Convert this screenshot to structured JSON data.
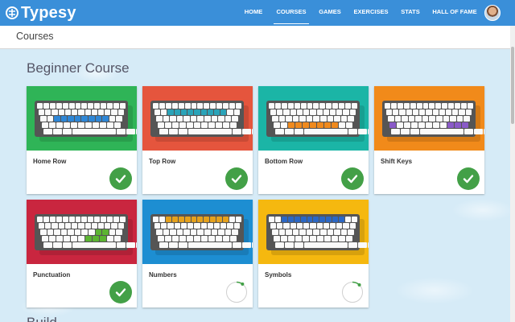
{
  "app": {
    "logo_text": "Typesy"
  },
  "nav": {
    "items": [
      {
        "label": "HOME",
        "active": false
      },
      {
        "label": "COURSES",
        "active": true
      },
      {
        "label": "GAMES",
        "active": false
      },
      {
        "label": "EXERCISES",
        "active": false
      },
      {
        "label": "STATS",
        "active": false
      },
      {
        "label": "HALL OF FAME",
        "active": false
      }
    ],
    "avatar_icon": "user-avatar"
  },
  "page": {
    "title": "Courses"
  },
  "sections": [
    {
      "title": "Beginner Course"
    },
    {
      "title": "Build..."
    }
  ],
  "cards": [
    {
      "label": "Home Row",
      "color": "#2fb457",
      "highlight": "#2e86d6",
      "row": 2,
      "status": "complete"
    },
    {
      "label": "Top Row",
      "color": "#e5553d",
      "highlight": "#2aa3b8",
      "row": 1,
      "status": "complete"
    },
    {
      "label": "Bottom Row",
      "color": "#1bb5a6",
      "highlight": "#ef8a1e",
      "row": 3,
      "status": "complete"
    },
    {
      "label": "Shift Keys",
      "color": "#f18a1a",
      "highlight": "#8a5ac8",
      "row": "shift",
      "status": "complete"
    },
    {
      "label": "Punctuation",
      "color": "#c9263f",
      "highlight": "#5bb432",
      "row": "punct",
      "status": "complete"
    },
    {
      "label": "Numbers",
      "color": "#1d8ed2",
      "highlight": "#e5a11c",
      "row": 0,
      "status": "in-progress",
      "progress": 0.1
    },
    {
      "label": "Symbols",
      "color": "#f5b80f",
      "highlight": "#2b67c4",
      "row": 0,
      "status": "in-progress",
      "progress": 0.12
    }
  ]
}
